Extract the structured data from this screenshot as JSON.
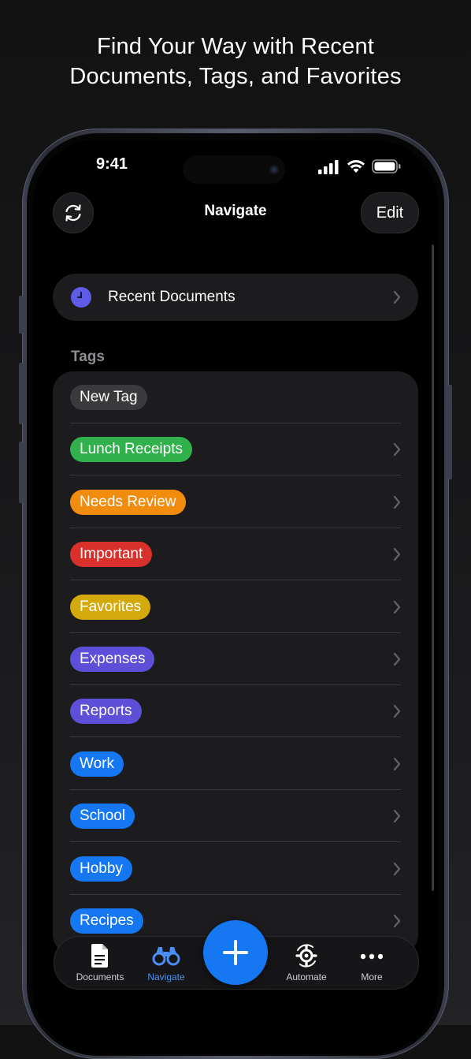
{
  "headline": {
    "line1": "Find Your Way with Recent",
    "line2": "Documents, Tags, and Favorites"
  },
  "status_bar": {
    "time": "9:41",
    "icons": [
      "signal-icon",
      "wifi-icon",
      "battery-icon"
    ]
  },
  "nav": {
    "title": "Navigate",
    "edit_label": "Edit",
    "left_icon": "sync-icon"
  },
  "recent": {
    "label": "Recent Documents",
    "icon": "clock-icon",
    "icon_color": "#5e5ce6"
  },
  "tags": {
    "section_label": "Tags",
    "items": [
      {
        "label": "New Tag",
        "color": "#3a3a3c",
        "has_chevron": false
      },
      {
        "label": "Lunch Receipts",
        "color": "#30b14b",
        "has_chevron": true
      },
      {
        "label": "Needs Review",
        "color": "#f28c0e",
        "has_chevron": true
      },
      {
        "label": "Important",
        "color": "#d9302b",
        "has_chevron": true
      },
      {
        "label": "Favorites",
        "color": "#d4a90c",
        "has_chevron": true
      },
      {
        "label": "Expenses",
        "color": "#5e4fd8",
        "has_chevron": true
      },
      {
        "label": "Reports",
        "color": "#5e4fd8",
        "has_chevron": true
      },
      {
        "label": "Work",
        "color": "#1677f2",
        "has_chevron": true
      },
      {
        "label": "School",
        "color": "#1677f2",
        "has_chevron": true
      },
      {
        "label": "Hobby",
        "color": "#1677f2",
        "has_chevron": true
      },
      {
        "label": "Recipes",
        "color": "#1677f2",
        "has_chevron": true
      }
    ]
  },
  "tab_bar": {
    "items": [
      {
        "label": "Documents",
        "icon": "document-icon",
        "active": false
      },
      {
        "label": "Navigate",
        "icon": "binoculars-icon",
        "active": true
      },
      {
        "label": "Automate",
        "icon": "automate-gear-icon",
        "active": false
      },
      {
        "label": "More",
        "icon": "ellipsis-icon",
        "active": false
      }
    ],
    "fab_icon": "plus-icon"
  },
  "colors": {
    "accent": "#1677f2",
    "active_tab": "#4a8ff5",
    "card_bg": "#1c1c1e"
  }
}
